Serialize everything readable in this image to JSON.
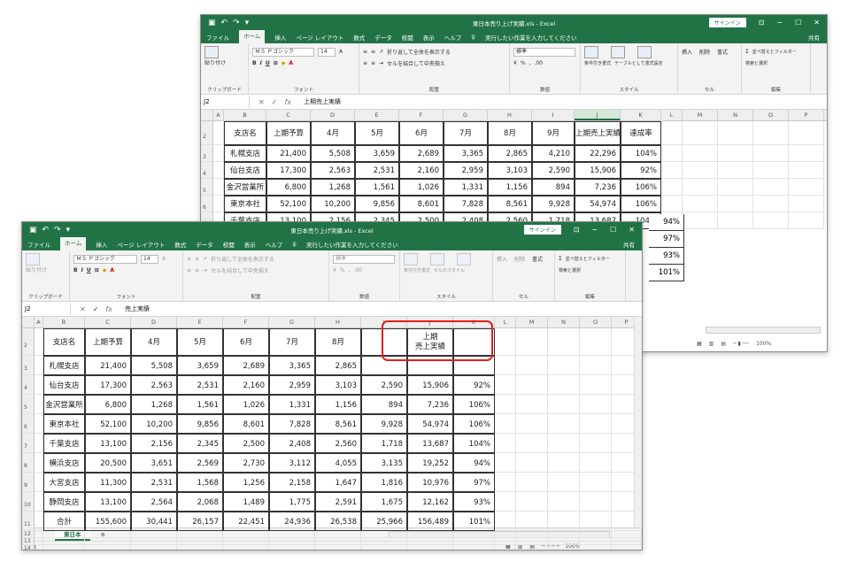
{
  "back": {
    "title": "東日本売り上げ実績.xls - Excel",
    "signin": "サインイン",
    "tabs": [
      "ファイル",
      "ホーム",
      "挿入",
      "ページ レイアウト",
      "数式",
      "データ",
      "校閲",
      "表示",
      "ヘルプ"
    ],
    "tellme": "実行したい作業を入力してください",
    "share": "共有",
    "font_name": "ＭＳ Ｐゴシック",
    "font_size": "14",
    "number_format": "標準",
    "wrap_text": "折り返して全体を表示する",
    "merge_center": "セルを結合して中央揃え",
    "groups": [
      "クリップボード",
      "フォント",
      "配置",
      "数値",
      "スタイル",
      "セル",
      "編集"
    ],
    "paste": "貼り付け",
    "cond_fmt": "条件付き書式",
    "table_fmt": "テーブルとして書式設定",
    "cell_style": "セルのスタイル",
    "insert": "挿入",
    "delete": "削除",
    "format": "書式",
    "sort": "並べ替えとフィルター",
    "find": "検索と選択",
    "namebox": "J2",
    "formula": "上期売上実績",
    "columns": [
      "A",
      "B",
      "C",
      "D",
      "E",
      "F",
      "G",
      "H",
      "I",
      "J",
      "K",
      "L",
      "M",
      "N",
      "O",
      "P"
    ],
    "rows": [
      {
        "n": "2",
        "cells": [
          "支店名",
          "上期予算",
          "4月",
          "5月",
          "6月",
          "7月",
          "8月",
          "9月",
          "上期売上実績",
          "達成率"
        ]
      },
      {
        "n": "3",
        "cells": [
          "札幌支店",
          "21,400",
          "5,508",
          "3,659",
          "2,689",
          "3,365",
          "2,865",
          "4,210",
          "22,296",
          "104%"
        ]
      },
      {
        "n": "4",
        "cells": [
          "仙台支店",
          "17,300",
          "2,563",
          "2,531",
          "2,160",
          "2,959",
          "3,103",
          "2,590",
          "15,906",
          "92%"
        ]
      },
      {
        "n": "5",
        "cells": [
          "金沢営業所",
          "6,800",
          "1,268",
          "1,561",
          "1,026",
          "1,331",
          "1,156",
          "894",
          "7,236",
          "106%"
        ]
      },
      {
        "n": "6",
        "cells": [
          "東京本社",
          "52,100",
          "10,200",
          "9,856",
          "8,601",
          "7,828",
          "8,561",
          "9,928",
          "54,974",
          "106%"
        ]
      },
      {
        "n": "7",
        "cells": [
          "千葉支店",
          "13,100",
          "2,156",
          "2,345",
          "2,500",
          "2,408",
          "2,560",
          "1,718",
          "13,687",
          "104%"
        ]
      }
    ],
    "side_pct": [
      "94%",
      "97%",
      "93%",
      "101%"
    ],
    "zoom": "100%"
  },
  "front": {
    "title": "東日本売り上げ実績.xls - Excel",
    "signin": "サインイン",
    "tabs": [
      "ファイル",
      "ホーム",
      "挿入",
      "ページ レイアウト",
      "数式",
      "データ",
      "校閲",
      "表示",
      "ヘルプ"
    ],
    "tellme": "実行したい作業を入力してください",
    "share": "共有",
    "font_name": "ＭＳ Ｐゴシック",
    "font_size": "14",
    "number_format": "標準",
    "wrap_text": "折り返して全体を表示する",
    "merge_center": "セルを結合して中央揃え",
    "groups": [
      "クリップボード",
      "フォント",
      "配置",
      "数値",
      "スタイル",
      "セル",
      "編集"
    ],
    "paste": "貼り付け",
    "cond_fmt": "条件付き書式",
    "table_fmt": "テーブルとして書式設定",
    "cell_style": "セルのスタイル",
    "insert": "挿入",
    "delete": "削除",
    "format": "書式",
    "sort": "並べ替えとフィルター",
    "find": "検索と選択",
    "namebox": "J2",
    "formula": "売上実績",
    "columns": [
      "A",
      "B",
      "C",
      "D",
      "E",
      "F",
      "G",
      "H",
      "I",
      "J",
      "K",
      "L",
      "M",
      "N",
      "O",
      "P"
    ],
    "rows": [
      {
        "n": "2",
        "cells": [
          "支店名",
          "上期予算",
          "4月",
          "5月",
          "6月",
          "7月",
          "8月",
          "",
          "上期\n売上実績",
          ""
        ]
      },
      {
        "n": "3",
        "cells": [
          "札幌支店",
          "21,400",
          "5,508",
          "3,659",
          "2,689",
          "3,365",
          "2,865",
          "",
          "",
          ""
        ]
      },
      {
        "n": "4",
        "cells": [
          "仙台支店",
          "17,300",
          "2,563",
          "2,531",
          "2,160",
          "2,959",
          "3,103",
          "2,590",
          "15,906",
          "92%"
        ]
      },
      {
        "n": "5",
        "cells": [
          "金沢営業所",
          "6,800",
          "1,268",
          "1,561",
          "1,026",
          "1,331",
          "1,156",
          "894",
          "7,236",
          "106%"
        ]
      },
      {
        "n": "6",
        "cells": [
          "東京本社",
          "52,100",
          "10,200",
          "9,856",
          "8,601",
          "7,828",
          "8,561",
          "9,928",
          "54,974",
          "106%"
        ]
      },
      {
        "n": "7",
        "cells": [
          "千葉支店",
          "13,100",
          "2,156",
          "2,345",
          "2,500",
          "2,408",
          "2,560",
          "1,718",
          "13,687",
          "104%"
        ]
      },
      {
        "n": "8",
        "cells": [
          "横浜支店",
          "20,500",
          "3,651",
          "2,569",
          "2,730",
          "3,112",
          "4,055",
          "3,135",
          "19,252",
          "94%"
        ]
      },
      {
        "n": "9",
        "cells": [
          "大宮支店",
          "11,300",
          "2,531",
          "1,568",
          "1,256",
          "2,158",
          "1,647",
          "1,816",
          "10,976",
          "97%"
        ]
      },
      {
        "n": "10",
        "cells": [
          "静岡支店",
          "13,100",
          "2,564",
          "2,068",
          "1,489",
          "1,775",
          "2,591",
          "1,675",
          "12,162",
          "93%"
        ]
      },
      {
        "n": "11",
        "cells": [
          "合計",
          "155,600",
          "30,441",
          "26,157",
          "22,451",
          "24,936",
          "26,538",
          "25,966",
          "156,489",
          "101%"
        ]
      }
    ],
    "empty_rows": [
      "12",
      "13",
      "14",
      "15"
    ],
    "sheet": "東日本",
    "status_mode": "編集",
    "zoom": "100%"
  }
}
